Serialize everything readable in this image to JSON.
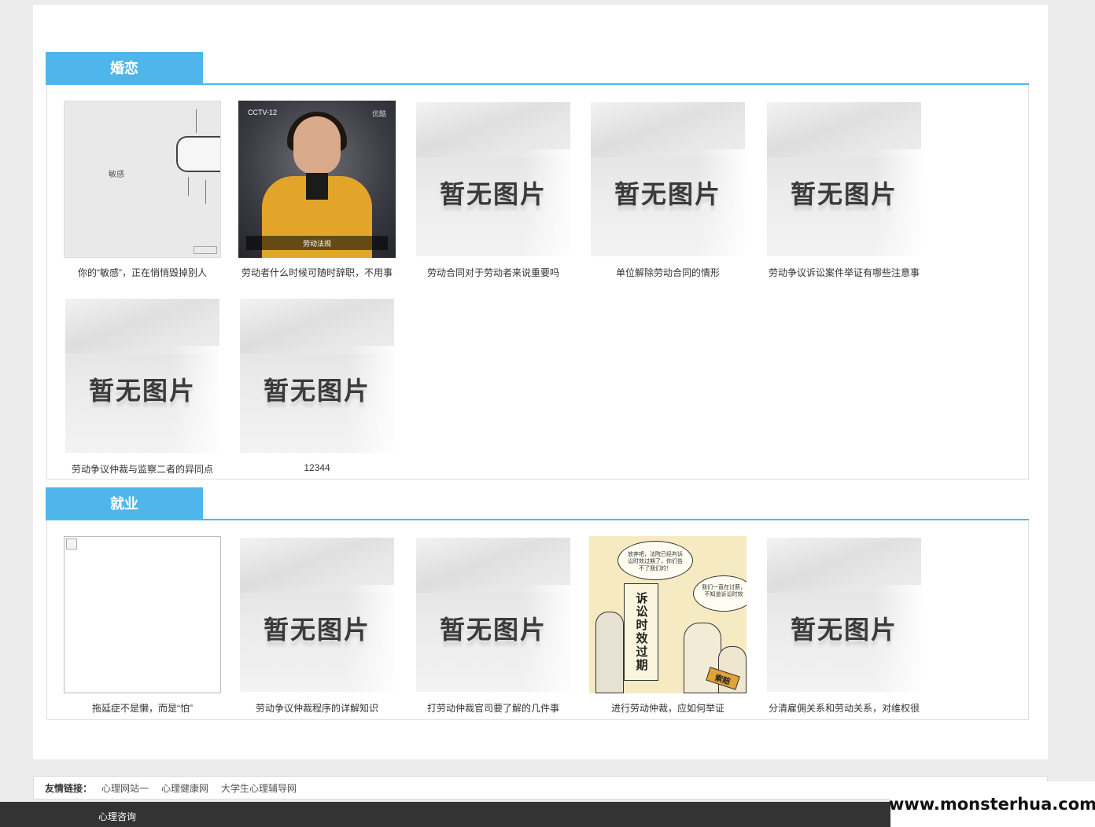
{
  "sections": [
    {
      "title": "婚恋",
      "cards": [
        {
          "title": "你的“敏感”，正在悄悄毁掉别人",
          "image": "sensitive-illustration",
          "image_text": "敏感"
        },
        {
          "title": "劳动者什么时候可随时辞职，不用事",
          "image": "news-anchor-photo",
          "image_text": {
            "logo": "CCTV-12",
            "tag": "优酷",
            "caption": "劳动法规"
          }
        },
        {
          "title": "劳动合同对于劳动者来说重要吗",
          "image": "placeholder",
          "image_text": "暂无图片"
        },
        {
          "title": "单位解除劳动合同的情形",
          "image": "placeholder",
          "image_text": "暂无图片"
        },
        {
          "title": "劳动争议诉讼案件举证有哪些注意事",
          "image": "placeholder",
          "image_text": "暂无图片"
        },
        {
          "title": "劳动争议仲裁与监察二者的异同点",
          "image": "placeholder",
          "image_text": "暂无图片"
        },
        {
          "title": "12344",
          "image": "placeholder",
          "image_text": "暂无图片"
        }
      ]
    },
    {
      "title": "就业",
      "cards": [
        {
          "title": "拖延症不是懒，而是“怕”",
          "image": "broken-image"
        },
        {
          "title": "劳动争议仲裁程序的详解知识",
          "image": "placeholder",
          "image_text": "暂无图片"
        },
        {
          "title": "打劳动仲裁官司要了解的几件事",
          "image": "placeholder",
          "image_text": "暂无图片"
        },
        {
          "title": "进行劳动仲裁，应如何举证",
          "image": "cartoon",
          "image_text": {
            "bubble1": "放弃吧，法院已经判诉讼时效过期了，你们告不了我们的！",
            "bubble2": "我们一直在讨薪，不知道诉讼时效",
            "scroll": "诉讼时效过期",
            "sign": "索赔"
          }
        },
        {
          "title": "分清雇佣关系和劳动关系，对维权很",
          "image": "placeholder",
          "image_text": "暂无图片"
        }
      ]
    }
  ],
  "friend_links": {
    "label": "友情链接：",
    "links": [
      "心理网站一",
      "心理健康网",
      "大学生心理辅导网"
    ]
  },
  "bottom_bar": {
    "item": "心理咨询"
  },
  "watermark": "www.monsterhua.com",
  "colors": {
    "accent": "#4fb6ec",
    "page_bg": "#ececec",
    "footer_bg": "#333333"
  }
}
